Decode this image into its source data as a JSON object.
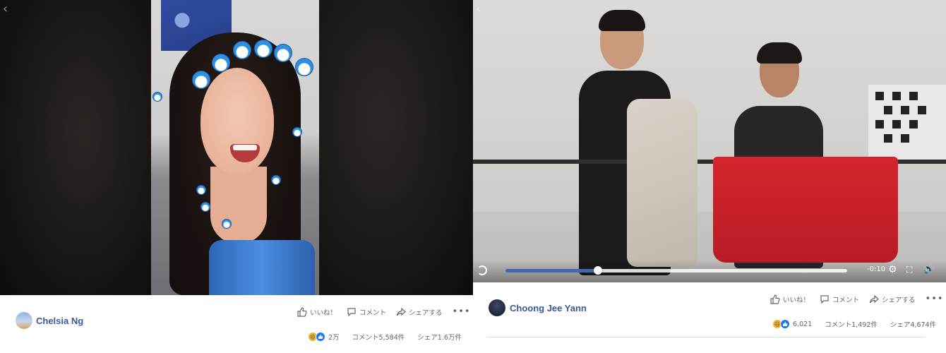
{
  "left_post": {
    "author_name": "Chelsia Ng",
    "actions": {
      "like": "いいね！",
      "comment": "コメント",
      "share": "シェアする"
    },
    "stats": {
      "reactions": "2万",
      "comments": "コメント5,584件",
      "shares": "シェア1.6万件"
    },
    "reactions": [
      "haha",
      "like"
    ]
  },
  "right_post": {
    "author_name": "Choong Jee Yann",
    "actions": {
      "like": "いいね！",
      "comment": "コメント",
      "share": "シェアする"
    },
    "stats": {
      "reactions": "6,021",
      "comments": "コメント1,492件",
      "shares": "シェア4,674件"
    },
    "reactions": [
      "haha",
      "like"
    ],
    "player": {
      "time_remaining": "-0:10",
      "progress": 0.27
    }
  },
  "colors": {
    "link": "#385898",
    "meta_text": "#606770",
    "like_blue": "#1877f2",
    "haha_yellow": "#f7b125",
    "player_progress": "#4267b2"
  },
  "icons": [
    "back-chevron-icon",
    "like-icon",
    "comment-icon",
    "share-icon",
    "more-icon",
    "replay-icon",
    "settings-icon",
    "fullscreen-icon",
    "volume-icon"
  ]
}
